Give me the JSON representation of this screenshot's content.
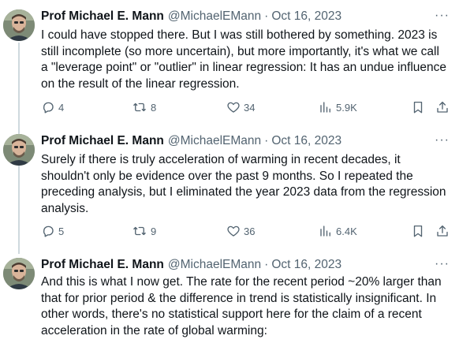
{
  "tweets": [
    {
      "author_name": "Prof Michael E. Mann",
      "handle": "@MichaelEMann",
      "separator": "·",
      "date": "Oct 16, 2023",
      "more_glyph": "···",
      "lines": [
        "I could have stopped there. But I was still bothered by something. 2023 is",
        "still incomplete (so more uncertain), but more importantly, it's what we call",
        "a \"leverage point\" or \"outlier\" in linear regression: It has an undue influence",
        "on the result of the linear regression."
      ],
      "replies": "4",
      "reposts": "8",
      "likes": "34",
      "views": "5.9K"
    },
    {
      "author_name": "Prof Michael E. Mann",
      "handle": "@MichaelEMann",
      "separator": "·",
      "date": "Oct 16, 2023",
      "more_glyph": "···",
      "lines": [
        "Surely if there is truly acceleration of warming in recent decades, it",
        "shouldn't only be evidence over the past 9 months. So I repeated the",
        "preceding analysis, but I eliminated the year 2023 data from the regression",
        "analysis."
      ],
      "replies": "5",
      "reposts": "9",
      "likes": "36",
      "views": "6.4K"
    },
    {
      "author_name": "Prof Michael E. Mann",
      "handle": "@MichaelEMann",
      "separator": "·",
      "date": "Oct 16, 2023",
      "more_glyph": "···",
      "lines": [
        "And this is what I now get.  The rate for the recent period ~20% larger than",
        "that for prior period & the difference in trend is statistically insignificant. In",
        "other words, there's no statistical support here for the claim of a recent",
        "acceleration in the rate of global warming:"
      ]
    }
  ],
  "icons": {
    "reply": "reply-icon",
    "repost": "repost-icon",
    "like": "like-icon",
    "views": "views-icon",
    "bookmark": "bookmark-icon",
    "share": "share-icon"
  },
  "colors": {
    "text": "#0f1419",
    "muted": "#536471",
    "thread_line": "#cfd9de"
  }
}
